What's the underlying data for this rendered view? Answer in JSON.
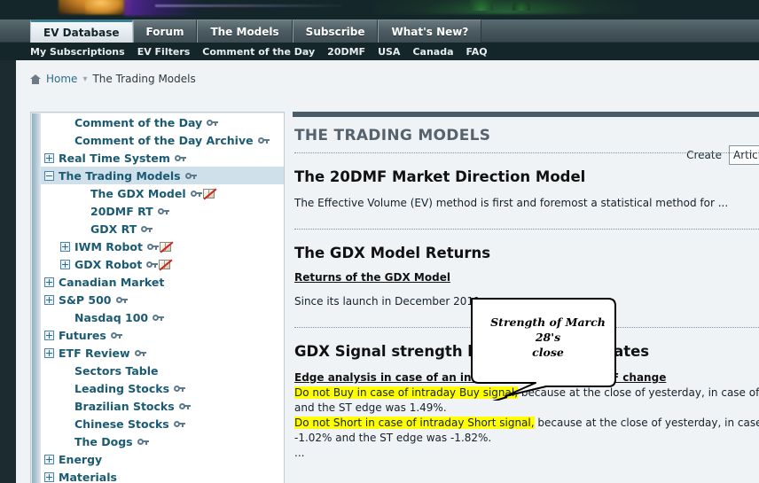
{
  "banner": {
    "alt": "site-banner-artwork"
  },
  "primary_tabs": [
    {
      "label": "EV Database",
      "active": true
    },
    {
      "label": "Forum",
      "active": false
    },
    {
      "label": "The Models",
      "active": false
    },
    {
      "label": "Subscribe",
      "active": false
    },
    {
      "label": "What's New?",
      "active": false
    }
  ],
  "secondary_nav": [
    "My Subscriptions",
    "EV Filters",
    "Comment of the Day",
    "20DMF",
    "USA",
    "Canada",
    "FAQ"
  ],
  "breadcrumb": {
    "home": "Home",
    "separator": "▾",
    "current": "The Trading Models"
  },
  "create": {
    "label": "Create",
    "selected": "Article",
    "options": [
      "Article"
    ]
  },
  "sidebar": {
    "items": [
      {
        "label": "Comment of the Day",
        "indent": 1,
        "toggle": "none",
        "key": true,
        "book": false,
        "selected": false
      },
      {
        "label": "Comment of the Day Archive",
        "indent": 1,
        "toggle": "none",
        "key": true,
        "book": false,
        "selected": false
      },
      {
        "label": "Real Time System",
        "indent": 0,
        "toggle": "plus",
        "key": true,
        "book": false,
        "selected": false
      },
      {
        "label": "The Trading Models",
        "indent": 0,
        "toggle": "minus",
        "key": true,
        "book": false,
        "selected": true
      },
      {
        "label": "The GDX Model",
        "indent": 2,
        "toggle": "none",
        "key": true,
        "book": true,
        "selected": false
      },
      {
        "label": "20DMF RT",
        "indent": 2,
        "toggle": "none",
        "key": true,
        "book": false,
        "selected": false
      },
      {
        "label": "GDX RT",
        "indent": 2,
        "toggle": "none",
        "key": true,
        "book": false,
        "selected": false
      },
      {
        "label": "IWM Robot",
        "indent": 1,
        "toggle": "plus",
        "key": true,
        "book": true,
        "selected": false
      },
      {
        "label": "GDX Robot",
        "indent": 1,
        "toggle": "plus",
        "key": true,
        "book": true,
        "selected": false
      },
      {
        "label": "Canadian Market",
        "indent": 0,
        "toggle": "plus",
        "key": false,
        "book": false,
        "selected": false
      },
      {
        "label": "S&P 500",
        "indent": 0,
        "toggle": "plus",
        "key": true,
        "book": false,
        "selected": false
      },
      {
        "label": "Nasdaq 100",
        "indent": 1,
        "toggle": "none",
        "key": true,
        "book": false,
        "selected": false
      },
      {
        "label": "Futures",
        "indent": 0,
        "toggle": "plus",
        "key": true,
        "book": false,
        "selected": false
      },
      {
        "label": "ETF Review",
        "indent": 0,
        "toggle": "plus",
        "key": true,
        "book": false,
        "selected": false
      },
      {
        "label": "Sectors Table",
        "indent": 1,
        "toggle": "none",
        "key": false,
        "book": false,
        "selected": false
      },
      {
        "label": "Leading Stocks",
        "indent": 1,
        "toggle": "none",
        "key": true,
        "book": false,
        "selected": false
      },
      {
        "label": "Brazilian Stocks",
        "indent": 1,
        "toggle": "none",
        "key": true,
        "book": false,
        "selected": false
      },
      {
        "label": "Chinese Stocks",
        "indent": 1,
        "toggle": "none",
        "key": true,
        "book": false,
        "selected": false
      },
      {
        "label": "The Dogs",
        "indent": 1,
        "toggle": "none",
        "key": true,
        "book": false,
        "selected": false
      },
      {
        "label": "Energy",
        "indent": 0,
        "toggle": "plus",
        "key": false,
        "book": false,
        "selected": false
      },
      {
        "label": "Materials",
        "indent": 0,
        "toggle": "plus",
        "key": false,
        "book": false,
        "selected": false
      }
    ]
  },
  "content": {
    "page_heading": "THE TRADING MODELS",
    "section1": {
      "title": "The 20DMF Market Direction Model",
      "body": "The Effective Volume (EV) method is first and foremost a statistical method for ..."
    },
    "section2": {
      "title": "The GDX Model Returns",
      "link": "Returns of the GDX Model",
      "body": "Since its launch in December 2011, as o"
    },
    "section3": {
      "title": "GDX Signal strength levels and RT updates",
      "subheading": "Edge analysis in case of an intraday real time GDX MF change",
      "line1_highlight": "Do not Buy in case of intraday Buy signal,",
      "line1_rest": " because at the close of yesterday, in case of a Buy signal",
      "line2": "and the ST edge was 1.49%.",
      "line3_highlight": "Do not Short in case of intraday Short signal,",
      "line3_rest": " because at the close of yesterday, in case of a Short",
      "line4": "-1.02% and the ST edge was -1.82%.",
      "line5": "..."
    }
  },
  "callout": {
    "text_line1": "Strength of March 28's",
    "text_line2": "close"
  },
  "colors": {
    "dark_nav": "#15262a",
    "tab_bar": "#46565d",
    "accent_blue": "#1b5a73",
    "page_bg": "#f0f3f6",
    "highlight_yellow": "#ffff00",
    "selected_row": "#cfe0ea",
    "content_topbar": "#4a5c68"
  }
}
